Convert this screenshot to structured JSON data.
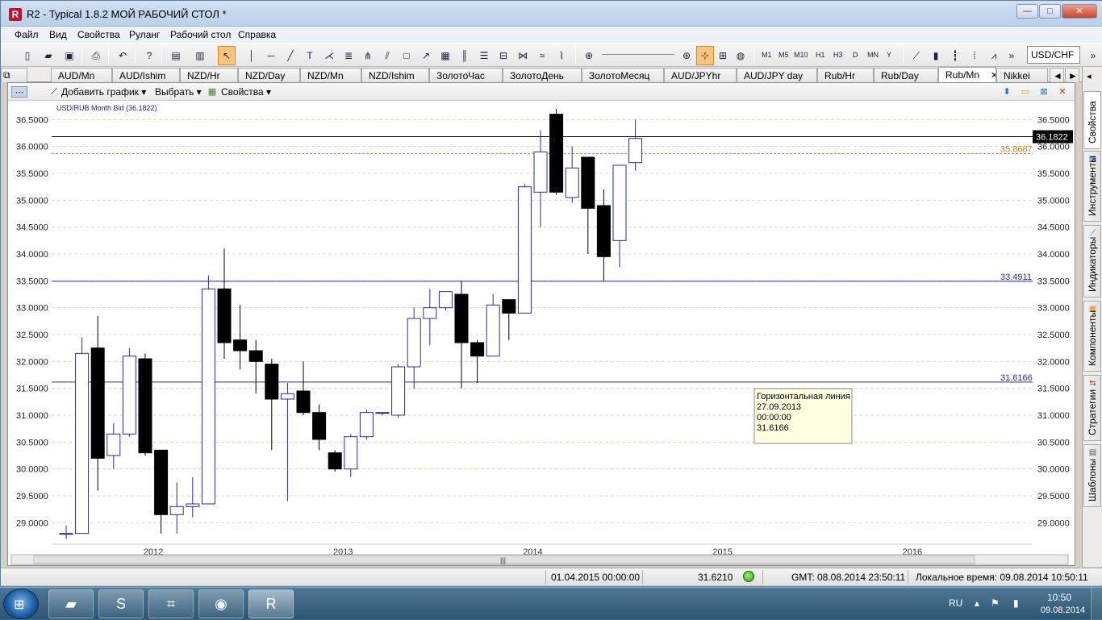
{
  "window": {
    "title": "R2 - Typical 1.8.2 МОЙ РАБОЧИЙ СТОЛ *",
    "logo": "R",
    "minimize": "—",
    "maximize": "□",
    "close": "✕"
  },
  "menu": [
    "Файл",
    "Вид",
    "Свойства",
    "Руланг",
    "Рабочий стол",
    "Справка"
  ],
  "toolbar": {
    "timeframes": [
      "M1",
      "M5",
      "M10",
      "H1",
      "H3",
      "D",
      "MN",
      "Y"
    ],
    "symbol": "USD/CHF",
    "overflow": "»"
  },
  "tabs": [
    {
      "label": "AUD/Mn"
    },
    {
      "label": "AUD/Ishim"
    },
    {
      "label": "NZD/Hr"
    },
    {
      "label": "NZD/Day"
    },
    {
      "label": "NZD/Mn"
    },
    {
      "label": "NZD/Ishim"
    },
    {
      "label": "ЗолотоЧас"
    },
    {
      "label": "ЗолотоДень"
    },
    {
      "label": "ЗолотоМесяц"
    },
    {
      "label": "AUD/JPYhr"
    },
    {
      "label": "AUD/JPY day"
    },
    {
      "label": "Rub/Hr"
    },
    {
      "label": "Rub/Day"
    },
    {
      "label": "Rub/Mn",
      "active": true
    },
    {
      "label": "Nikkei"
    }
  ],
  "tab_close": "✕",
  "tab_nav": {
    "prev": "◄",
    "next": "►"
  },
  "chart_toolbar": {
    "add_chart": "Добавить график",
    "select": "Выбрать",
    "properties": "Свойства"
  },
  "side_tabs": [
    "Свойства",
    "Инструменты",
    "Индикаторы",
    "Компоненты",
    "Стратегии",
    "Шаблоны"
  ],
  "chart_data": {
    "type": "candlestick",
    "title": "USD/RUB Month Bid (36.1822)",
    "ylim": [
      28.6,
      36.85
    ],
    "yticks": [
      29.0,
      29.5,
      30.0,
      30.5,
      31.0,
      31.5,
      32.0,
      32.5,
      33.0,
      33.5,
      34.0,
      34.5,
      35.0,
      35.5,
      36.0,
      36.5
    ],
    "ytick_labels": [
      "29.0000",
      "29.5000",
      "30.0000",
      "30.5000",
      "31.0000",
      "31.5000",
      "32.0000",
      "32.5000",
      "33.0000",
      "33.5000",
      "34.0000",
      "34.5000",
      "35.0000",
      "35.5000",
      "36.0000",
      "36.5000"
    ],
    "xtick_labels": [
      "2012",
      "2013",
      "2014",
      "2015",
      "2016"
    ],
    "xtick_index": [
      5.5,
      17.5,
      29.5,
      41.5,
      53.5
    ],
    "up_color": "#2a2aa8",
    "down_color": "#000000",
    "candles": [
      {
        "o": 28.8,
        "h": 28.95,
        "l": 28.7,
        "c": 28.8
      },
      {
        "o": 28.8,
        "h": 32.45,
        "l": 28.8,
        "c": 32.15
      },
      {
        "o": 32.25,
        "h": 32.85,
        "l": 29.6,
        "c": 30.2
      },
      {
        "o": 30.25,
        "h": 30.85,
        "l": 30.0,
        "c": 30.65
      },
      {
        "o": 30.65,
        "h": 32.25,
        "l": 30.6,
        "c": 32.1
      },
      {
        "o": 32.05,
        "h": 32.15,
        "l": 30.25,
        "c": 30.3
      },
      {
        "o": 30.35,
        "h": 30.35,
        "l": 28.8,
        "c": 29.15
      },
      {
        "o": 29.15,
        "h": 29.75,
        "l": 28.8,
        "c": 29.3
      },
      {
        "o": 29.3,
        "h": 29.85,
        "l": 29.1,
        "c": 29.35
      },
      {
        "o": 29.35,
        "h": 33.6,
        "l": 29.35,
        "c": 33.35
      },
      {
        "o": 33.35,
        "h": 34.1,
        "l": 32.05,
        "c": 32.35
      },
      {
        "o": 32.4,
        "h": 33.05,
        "l": 31.85,
        "c": 32.2
      },
      {
        "o": 32.2,
        "h": 32.4,
        "l": 31.4,
        "c": 32.0
      },
      {
        "o": 31.95,
        "h": 32.05,
        "l": 30.35,
        "c": 31.3
      },
      {
        "o": 31.3,
        "h": 31.6,
        "l": 29.4,
        "c": 31.4
      },
      {
        "o": 31.45,
        "h": 32.0,
        "l": 31.0,
        "c": 31.05
      },
      {
        "o": 31.05,
        "h": 31.2,
        "l": 30.35,
        "c": 30.55
      },
      {
        "o": 30.3,
        "h": 30.35,
        "l": 29.95,
        "c": 30.0
      },
      {
        "o": 30.0,
        "h": 30.65,
        "l": 29.85,
        "c": 30.6
      },
      {
        "o": 30.6,
        "h": 31.1,
        "l": 30.55,
        "c": 31.05
      },
      {
        "o": 31.05,
        "h": 31.05,
        "l": 31.0,
        "c": 31.05
      },
      {
        "o": 31.0,
        "h": 31.95,
        "l": 30.95,
        "c": 31.9
      },
      {
        "o": 31.9,
        "h": 33.0,
        "l": 31.5,
        "c": 32.8
      },
      {
        "o": 32.8,
        "h": 33.35,
        "l": 32.3,
        "c": 33.0
      },
      {
        "o": 33.0,
        "h": 33.3,
        "l": 32.95,
        "c": 33.3
      },
      {
        "o": 33.25,
        "h": 33.5,
        "l": 31.5,
        "c": 32.35
      },
      {
        "o": 32.35,
        "h": 32.4,
        "l": 31.6,
        "c": 32.1
      },
      {
        "o": 32.1,
        "h": 33.25,
        "l": 32.1,
        "c": 33.05
      },
      {
        "o": 33.15,
        "h": 33.15,
        "l": 32.4,
        "c": 32.9
      },
      {
        "o": 32.9,
        "h": 35.3,
        "l": 32.9,
        "c": 35.25
      },
      {
        "o": 35.15,
        "h": 36.3,
        "l": 34.5,
        "c": 35.9
      },
      {
        "o": 36.6,
        "h": 36.7,
        "l": 35.1,
        "c": 35.15
      },
      {
        "o": 35.05,
        "h": 36.0,
        "l": 34.95,
        "c": 35.6
      },
      {
        "o": 35.8,
        "h": 35.8,
        "l": 34.0,
        "c": 34.85
      },
      {
        "o": 34.9,
        "h": 35.2,
        "l": 33.5,
        "c": 33.95
      },
      {
        "o": 34.25,
        "h": 35.65,
        "l": 33.75,
        "c": 35.65
      },
      {
        "o": 35.7,
        "h": 36.5,
        "l": 35.55,
        "c": 36.15
      }
    ],
    "hlines": [
      {
        "value": 36.1822,
        "label": "36.1822",
        "color": "#000000",
        "style": "solid",
        "badge": true
      },
      {
        "value": 35.8687,
        "label": "35.8687",
        "color": "#e0782a",
        "style": "dashed"
      },
      {
        "value": 33.4911,
        "label": "33.4911",
        "color": "#2a2aa8",
        "style": "solid"
      },
      {
        "value": 31.6166,
        "label": "31.6166",
        "color": "#2a2aa8",
        "style": "solid"
      }
    ],
    "tooltip": {
      "lines": [
        "Горизонтальная линия",
        "27.09.2013",
        "00:00:00",
        "31.6166"
      ]
    },
    "grid": true
  },
  "status": {
    "datetime": "01.04.2015 00:00:00",
    "price": "31.6210",
    "gmt": "GMT:  08.08.2014 23:50:11",
    "local": "Локальное время:  09.08.2014 10:50:11"
  },
  "taskbar": {
    "lang": "RU",
    "time": "10:50",
    "date": "09.08.2014"
  }
}
